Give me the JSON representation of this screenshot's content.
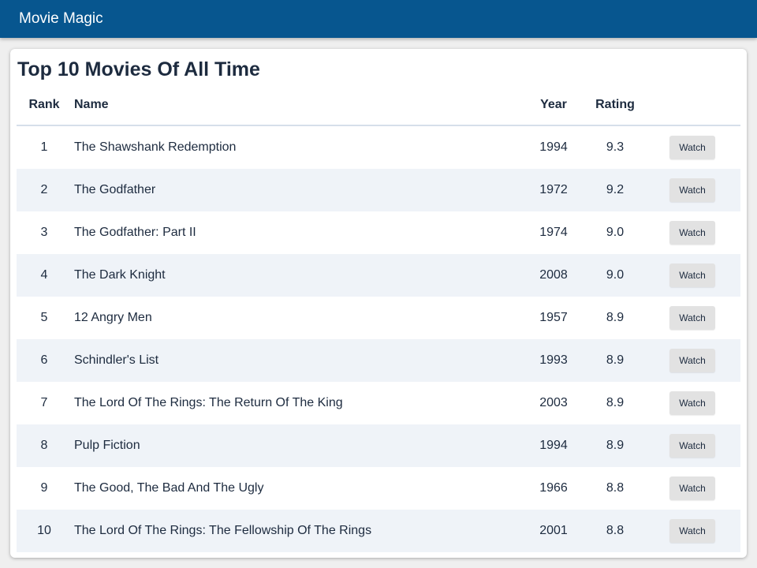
{
  "app": {
    "title": "Movie Magic"
  },
  "page": {
    "title": "Top 10 Movies Of All Time"
  },
  "table": {
    "headers": {
      "rank": "Rank",
      "name": "Name",
      "year": "Year",
      "rating": "Rating",
      "action": ""
    },
    "rows": [
      {
        "rank": "1",
        "name": "The Shawshank Redemption",
        "year": "1994",
        "rating": "9.3",
        "action": "Watch"
      },
      {
        "rank": "2",
        "name": "The Godfather",
        "year": "1972",
        "rating": "9.2",
        "action": "Watch"
      },
      {
        "rank": "3",
        "name": "The Godfather: Part II",
        "year": "1974",
        "rating": "9.0",
        "action": "Watch"
      },
      {
        "rank": "4",
        "name": "The Dark Knight",
        "year": "2008",
        "rating": "9.0",
        "action": "Watch"
      },
      {
        "rank": "5",
        "name": "12 Angry Men",
        "year": "1957",
        "rating": "8.9",
        "action": "Watch"
      },
      {
        "rank": "6",
        "name": "Schindler's List",
        "year": "1993",
        "rating": "8.9",
        "action": "Watch"
      },
      {
        "rank": "7",
        "name": "The Lord Of The Rings: The Return Of The King",
        "year": "2003",
        "rating": "8.9",
        "action": "Watch"
      },
      {
        "rank": "8",
        "name": "Pulp Fiction",
        "year": "1994",
        "rating": "8.9",
        "action": "Watch"
      },
      {
        "rank": "9",
        "name": "The Good, The Bad And The Ugly",
        "year": "1966",
        "rating": "8.8",
        "action": "Watch"
      },
      {
        "rank": "10",
        "name": "The Lord Of The Rings: The Fellowship Of The Rings",
        "year": "2001",
        "rating": "8.8",
        "action": "Watch"
      }
    ]
  },
  "colors": {
    "header_bg": "#07568f",
    "header_text": "#ffffff",
    "row_alt_bg": "#eff3f8",
    "button_bg": "#e2e2e2",
    "text": "#1d2b3f"
  }
}
